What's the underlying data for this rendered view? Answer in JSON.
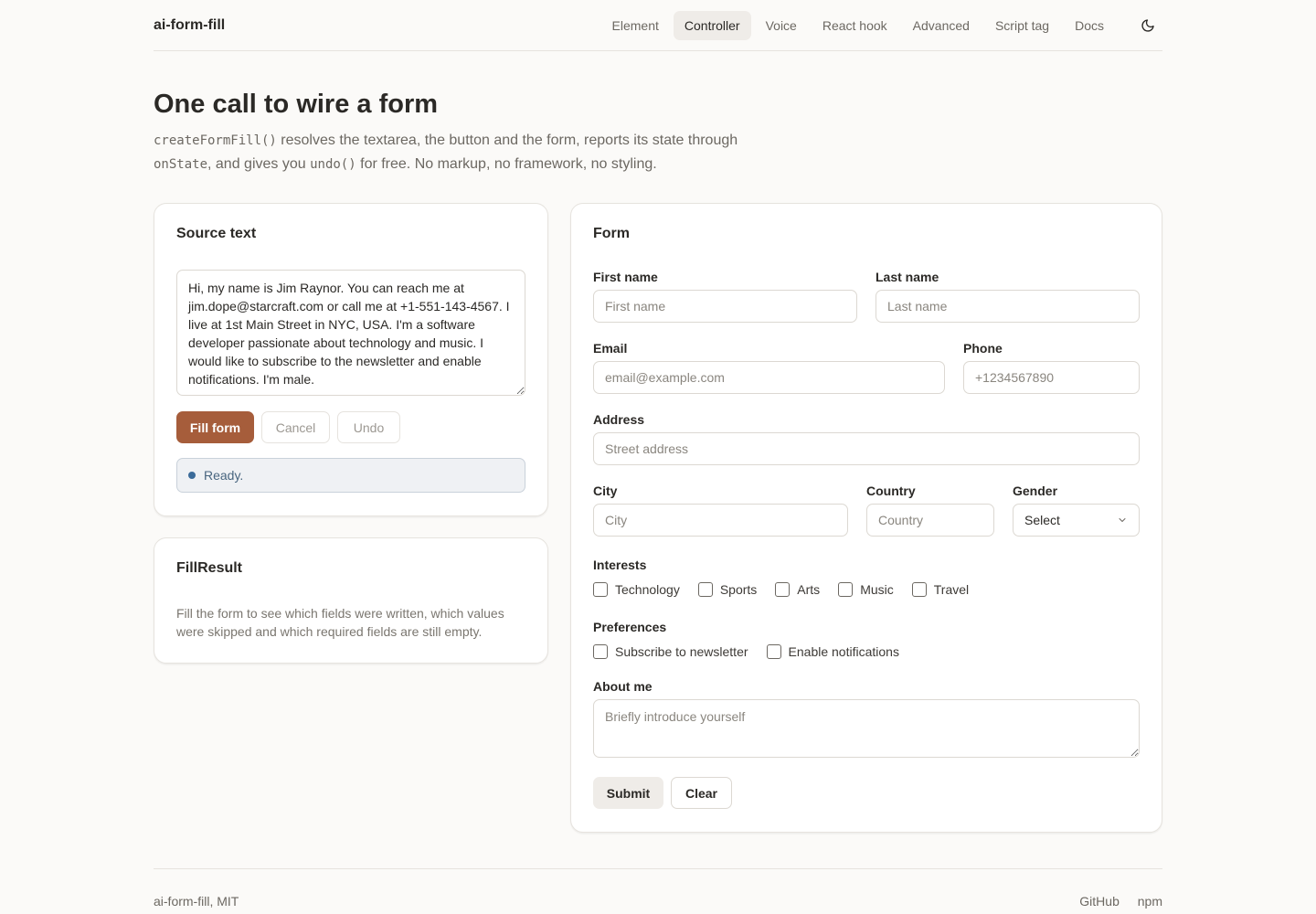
{
  "brand": "ai-form-fill",
  "nav": {
    "items": [
      {
        "label": "Element"
      },
      {
        "label": "Controller"
      },
      {
        "label": "Voice"
      },
      {
        "label": "React hook"
      },
      {
        "label": "Advanced"
      },
      {
        "label": "Script tag"
      },
      {
        "label": "Docs"
      }
    ],
    "active": "Controller",
    "theme_icon": "moon-icon"
  },
  "hero": {
    "title": "One call to wire a form",
    "code_create": "createFormFill()",
    "text_1": " resolves the textarea, the button and the form, reports its state through ",
    "code_onstate": "onState",
    "text_2": ", and gives you ",
    "code_undo": "undo()",
    "text_3": " for free. No markup, no framework, no styling."
  },
  "source": {
    "title": "Source text",
    "text": "Hi, my name is Jim Raynor. You can reach me at jim.dope@starcraft.com or call me at +1-551-143-4567. I live at 1st Main Street in NYC, USA. I'm a software developer passionate about technology and music. I would like to subscribe to the newsletter and enable notifications. I'm male.",
    "fill_label": "Fill form",
    "cancel_label": "Cancel",
    "undo_label": "Undo",
    "status": "Ready.",
    "status_color": "#3b6b99"
  },
  "result": {
    "title": "FillResult",
    "description": "Fill the form to see which fields were written, which values were skipped and which required fields are still empty."
  },
  "form": {
    "title": "Form",
    "first_name": {
      "label": "First name",
      "placeholder": "First name"
    },
    "last_name": {
      "label": "Last name",
      "placeholder": "Last name"
    },
    "email": {
      "label": "Email",
      "placeholder": "email@example.com"
    },
    "phone": {
      "label": "Phone",
      "placeholder": "+1234567890"
    },
    "address": {
      "label": "Address",
      "placeholder": "Street address"
    },
    "city": {
      "label": "City",
      "placeholder": "City"
    },
    "country": {
      "label": "Country",
      "placeholder": "Country"
    },
    "gender": {
      "label": "Gender",
      "value": "Select"
    },
    "interests": {
      "label": "Interests",
      "options": [
        "Technology",
        "Sports",
        "Arts",
        "Music",
        "Travel"
      ]
    },
    "preferences": {
      "label": "Preferences",
      "options": [
        "Subscribe to newsletter",
        "Enable notifications"
      ]
    },
    "about": {
      "label": "About me",
      "placeholder": "Briefly introduce yourself"
    },
    "submit_label": "Submit",
    "clear_label": "Clear"
  },
  "footer": {
    "left": "ai-form-fill, MIT",
    "links": [
      "GitHub",
      "npm"
    ]
  },
  "colors": {
    "accent": "#a65d3b",
    "background": "#fbfaf8"
  }
}
